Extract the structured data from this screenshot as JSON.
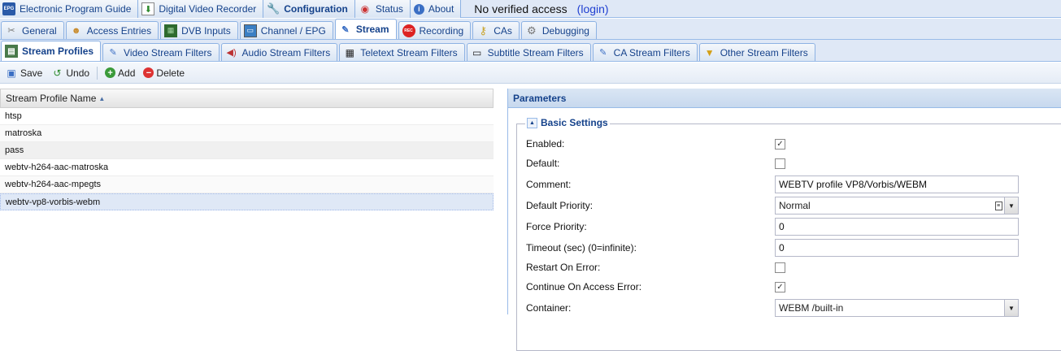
{
  "top_tabs": [
    {
      "label": "Electronic Program Guide",
      "icon": "epg-icon",
      "glyph": "EPG"
    },
    {
      "label": "Digital Video Recorder",
      "icon": "dvr-download-icon",
      "glyph": "⬇"
    },
    {
      "label": "Configuration",
      "icon": "wrench-icon",
      "glyph": "🔧"
    },
    {
      "label": "Status",
      "icon": "eye-icon",
      "glyph": "👁"
    },
    {
      "label": "About",
      "icon": "info-icon",
      "glyph": "i"
    }
  ],
  "access": {
    "text": "No verified access",
    "login": "(login)"
  },
  "config_tabs": [
    {
      "label": "General",
      "icon": "tools-icon",
      "glyph": "✂"
    },
    {
      "label": "Access Entries",
      "icon": "users-icon",
      "glyph": "👥"
    },
    {
      "label": "DVB Inputs",
      "icon": "card-icon",
      "glyph": "▦"
    },
    {
      "label": "Channel / EPG",
      "icon": "tv-icon",
      "glyph": "📺"
    },
    {
      "label": "Stream",
      "icon": "stream-icon",
      "glyph": "✎"
    },
    {
      "label": "Recording",
      "icon": "rec-icon",
      "glyph": "REC"
    },
    {
      "label": "CAs",
      "icon": "key-icon",
      "glyph": "🔑"
    },
    {
      "label": "Debugging",
      "icon": "bug-icon",
      "glyph": "⚙"
    }
  ],
  "stream_tabs": [
    {
      "label": "Stream Profiles",
      "icon": "profiles-icon",
      "glyph": "▤"
    },
    {
      "label": "Video Stream Filters",
      "icon": "video-filter-icon",
      "glyph": "✎"
    },
    {
      "label": "Audio Stream Filters",
      "icon": "audio-icon",
      "glyph": "🔊"
    },
    {
      "label": "Teletext Stream Filters",
      "icon": "teletext-icon",
      "glyph": "▦"
    },
    {
      "label": "Subtitle Stream Filters",
      "icon": "subtitle-icon",
      "glyph": "▭"
    },
    {
      "label": "CA Stream Filters",
      "icon": "ca-filter-icon",
      "glyph": "✎"
    },
    {
      "label": "Other Stream Filters",
      "icon": "funnel-icon",
      "glyph": "▼"
    }
  ],
  "toolbar": {
    "save": "Save",
    "undo": "Undo",
    "add": "Add",
    "delete": "Delete"
  },
  "grid": {
    "column": "Stream Profile Name",
    "rows": [
      "htsp",
      "matroska",
      "pass",
      "webtv-h264-aac-matroska",
      "webtv-h264-aac-mpegts",
      "webtv-vp8-vorbis-webm"
    ]
  },
  "panel": {
    "title": "Parameters",
    "section": "Basic Settings",
    "fields": {
      "enabled": {
        "label": "Enabled:",
        "checked": true
      },
      "default": {
        "label": "Default:",
        "checked": false
      },
      "comment": {
        "label": "Comment:",
        "value": "WEBTV profile VP8/Vorbis/WEBM"
      },
      "priority": {
        "label": "Default Priority:",
        "value": "Normal"
      },
      "force_priority": {
        "label": "Force Priority:",
        "value": "0"
      },
      "timeout": {
        "label": "Timeout (sec) (0=infinite):",
        "value": "0"
      },
      "restart": {
        "label": "Restart On Error:",
        "checked": false
      },
      "continue": {
        "label": "Continue On Access Error:",
        "checked": true
      },
      "container": {
        "label": "Container:",
        "value": "WEBM /built-in"
      }
    }
  }
}
